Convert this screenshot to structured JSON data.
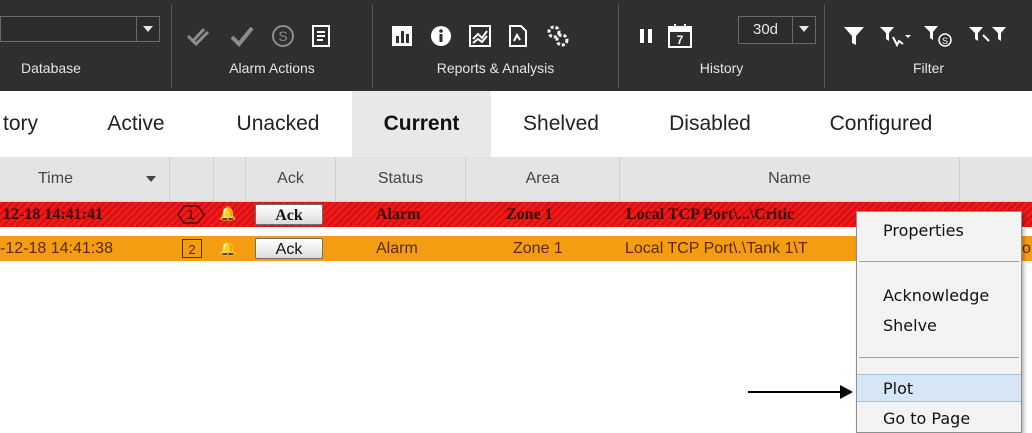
{
  "ribbon": {
    "groups": {
      "database": "Database",
      "alarm_actions": "Alarm Actions",
      "reports": "Reports & Analysis",
      "history": "History",
      "filter": "Filter"
    },
    "history_range": "30d",
    "icons": {
      "ack_all": "double-check-icon",
      "ack": "check-icon",
      "shelve": "shelve-s-icon",
      "notes": "notes-icon",
      "chart": "bar-chart-icon",
      "info": "info-icon",
      "trend": "trend-icon",
      "report": "report-icon",
      "settings": "gears-icon",
      "pause": "pause-icon",
      "calendar_day": "7",
      "filter": "filter-icon",
      "filter_select": "filter-select-icon",
      "filter_shelved": "filter-shelved-icon",
      "filter_clear": "filter-clear-icon"
    }
  },
  "tabs": [
    "tory",
    "Active",
    "Unacked",
    "Current",
    "Shelved",
    "Disabled",
    "Configured"
  ],
  "active_tab": "Current",
  "columns": {
    "time": "Time",
    "ack": "Ack",
    "status": "Status",
    "area": "Area",
    "name": "Name"
  },
  "rows": [
    {
      "time": "12-18  14:41:41",
      "priority": "1",
      "ack_label": "Ack",
      "status": "Alarm",
      "area": "Zone 1",
      "name": "Local TCP Port\\...\\Critic",
      "color": "#e8171a"
    },
    {
      "time": "-12-18  14:41:38",
      "priority": "2",
      "ack_label": "Ack",
      "status": "Alarm",
      "area": "Zone 1",
      "name": "Local TCP Port\\.\\Tank 1\\T",
      "color": "#f49d12"
    }
  ],
  "context_menu": {
    "properties": "Properties",
    "acknowledge": "Acknowledge",
    "shelve": "Shelve",
    "plot": "Plot",
    "go_to_page": "Go to Page"
  }
}
